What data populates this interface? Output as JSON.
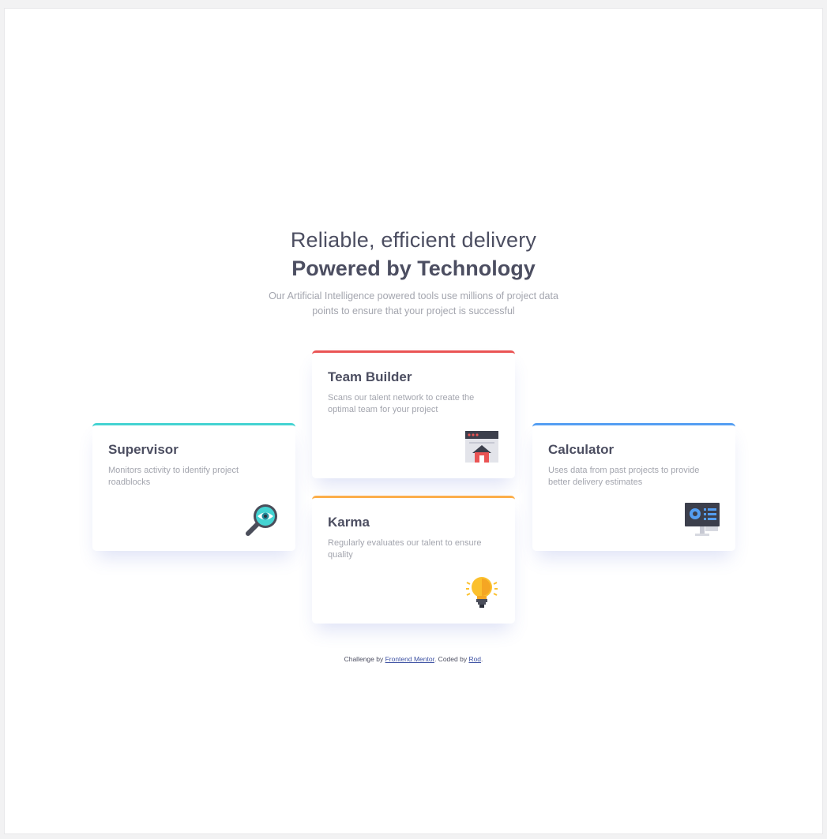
{
  "header": {
    "subtitle": "Reliable, efficient delivery",
    "title": "Powered by Technology",
    "description": "Our Artificial Intelligence powered tools use millions of project data points to ensure that your project is successful"
  },
  "cards": [
    {
      "title": "Supervisor",
      "text": "Monitors activity to identify project roadblocks",
      "icon": "magnifier-eye-icon",
      "accent": "#44d3d2"
    },
    {
      "title": "Team Builder",
      "text": "Scans our talent network to create the optimal team for your project",
      "icon": "team-builder-icon",
      "accent": "#ea5454"
    },
    {
      "title": "Karma",
      "text": "Regularly evaluates our talent to ensure quality",
      "icon": "lightbulb-icon",
      "accent": "#fcae4a"
    },
    {
      "title": "Calculator",
      "text": "Uses data from past projects to provide better delivery estimates",
      "icon": "monitor-calculator-icon",
      "accent": "#549ef2"
    }
  ],
  "footer": {
    "prefix": "Challenge by ",
    "challenge_link": "Frontend Mentor",
    "middle": ". Coded by ",
    "author_link": "Rod",
    "suffix": "."
  },
  "colors": {
    "heading": "#4c4e61",
    "muted": "#a3a5ae",
    "cyan": "#44d3d2",
    "red": "#ea5454",
    "orange": "#fcae4a",
    "blue": "#549ef2"
  }
}
